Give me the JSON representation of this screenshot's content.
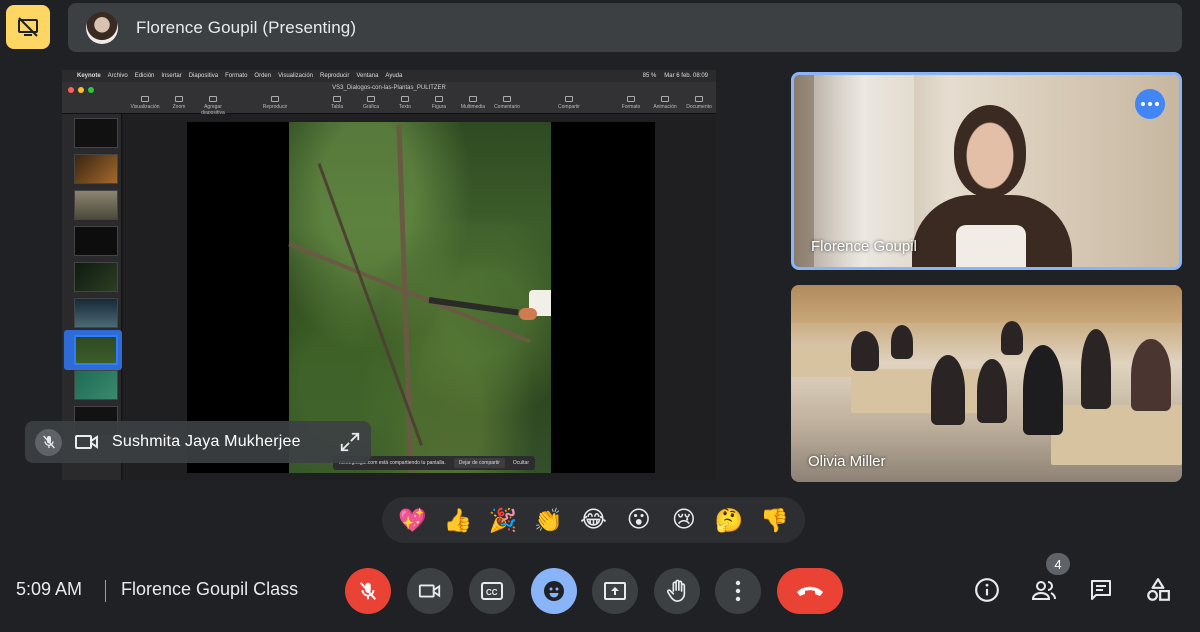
{
  "presenting_bar": {
    "text": "Florence Goupil (Presenting)"
  },
  "shared_screen": {
    "menubar": {
      "items": [
        "Keynote",
        "Archivo",
        "Edición",
        "Insertar",
        "Diapositiva",
        "Formato",
        "Orden",
        "Visualización",
        "Reproducir",
        "Ventana",
        "Ayuda"
      ],
      "clock": "Mar 6 feb. 08:09",
      "battery": "85 %"
    },
    "document_title": "VS3_Dialogos-con-las-Plantas_PULITZER",
    "toolbar": [
      "Visualización",
      "Zoom",
      "Agregar diapositiva",
      "Reproducir",
      "Tabla",
      "Gráfica",
      "Texto",
      "Figura",
      "Multimedia",
      "Comentario",
      "Compartir",
      "Formato",
      "Animación",
      "Documento"
    ],
    "zoom": "100 %",
    "share_notice": {
      "text": "meet.google.com está compartiendo tu pantalla.",
      "stop": "Dejar de compartir",
      "hide": "Ocultar"
    }
  },
  "self_tile": {
    "name": "Sushmita Jaya Mukherjee"
  },
  "participants": [
    {
      "name": "Florence Goupil"
    },
    {
      "name": "Olivia Miller"
    }
  ],
  "reactions": [
    "💖",
    "👍",
    "🎉",
    "👏",
    "😂",
    "😮",
    "😢",
    "🤔",
    "👎"
  ],
  "bottom_bar": {
    "time": "5:09 AM",
    "meeting_name": "Florence Goupil Class",
    "participant_count": "4"
  },
  "colors": {
    "background": "#202124",
    "accent_yellow": "#fdd663",
    "active_blue": "#8ab4f8",
    "danger_red": "#ea4335"
  }
}
